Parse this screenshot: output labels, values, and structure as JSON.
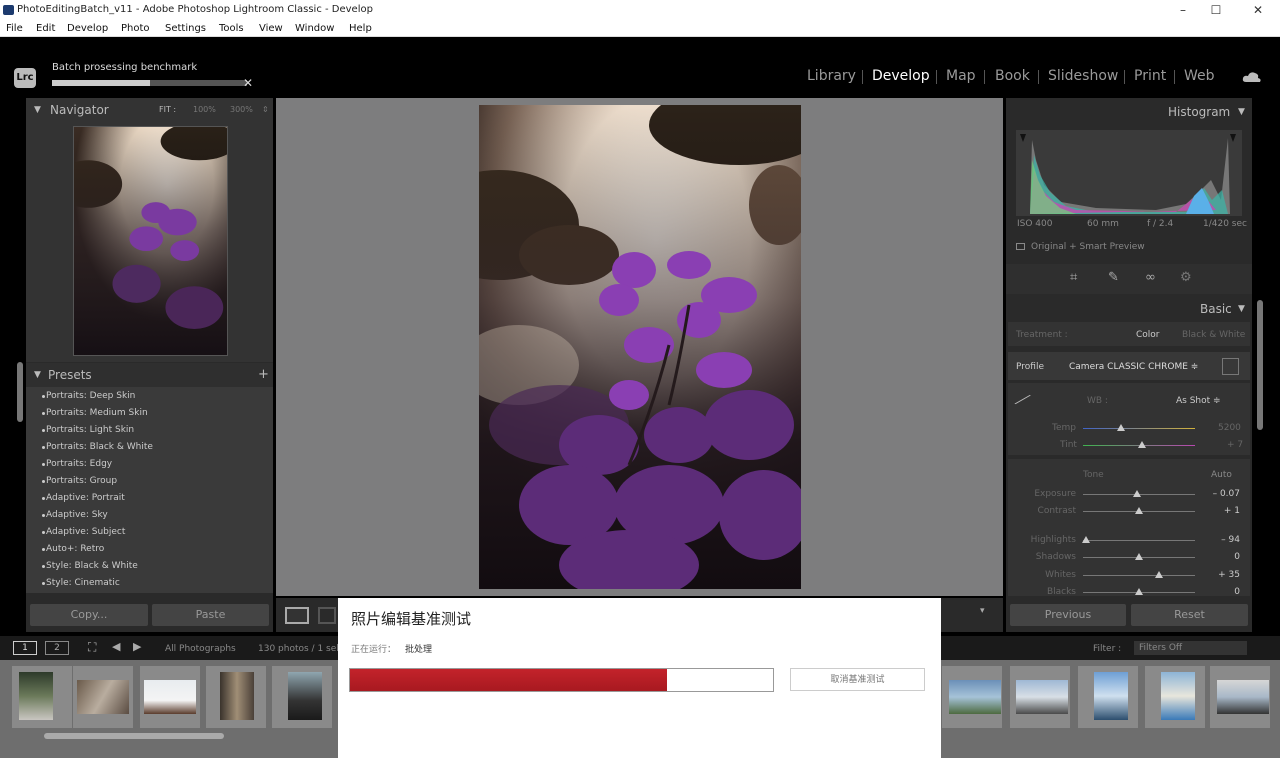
{
  "window": {
    "title": "PhotoEditingBatch_v11 - Adobe Photoshop Lightroom Classic - Develop",
    "controls": [
      "–",
      "☐",
      "✕"
    ]
  },
  "menu": [
    "File",
    "Edit",
    "Develop",
    "Photo",
    "Settings",
    "Tools",
    "View",
    "Window",
    "Help"
  ],
  "app": {
    "logo": "Lrc"
  },
  "background_job": {
    "label": "Batch prosessing benchmark",
    "progress": 0.5
  },
  "modules": [
    "Library",
    "Develop",
    "Map",
    "Book",
    "Slideshow",
    "Print",
    "Web"
  ],
  "active_module": "Develop",
  "navigator": {
    "title": "Navigator",
    "zoom_options": [
      "FIT :",
      "100%",
      "300%"
    ]
  },
  "presets": {
    "title": "Presets",
    "items": [
      "Portraits: Deep Skin",
      "Portraits: Medium Skin",
      "Portraits: Light Skin",
      "Portraits: Black & White",
      "Portraits: Edgy",
      "Portraits: Group",
      "Adaptive: Portrait",
      "Adaptive: Sky",
      "Adaptive: Subject",
      "Auto+: Retro",
      "Style: Black & White",
      "Style: Cinematic"
    ]
  },
  "left_buttons": {
    "copy": "Copy...",
    "paste": "Paste"
  },
  "histogram": {
    "title": "Histogram",
    "iso": "ISO 400",
    "focal": "60 mm",
    "aperture": "f / 2.4",
    "shutter": "1/420 sec",
    "preview": "Original + Smart Preview"
  },
  "basic": {
    "title": "Basic",
    "treatment_label": "Treatment :",
    "treatment_color": "Color",
    "treatment_bw": "Black & White",
    "profile_label": "Profile",
    "profile_value": "Camera CLASSIC CHROME ≑",
    "wb_label": "WB :",
    "wb_value": "As Shot ≑",
    "temp_label": "Temp",
    "temp_value": "5200",
    "tint_label": "Tint",
    "tint_value": "+ 7",
    "tone_label": "Tone",
    "tone_auto": "Auto",
    "sliders": [
      {
        "label": "Exposure",
        "value": "– 0.07",
        "level": 0.48
      },
      {
        "label": "Contrast",
        "value": "+ 1",
        "level": 0.5
      },
      {
        "label": "Highlights",
        "value": "– 94",
        "level": 0.03
      },
      {
        "label": "Shadows",
        "value": "0",
        "level": 0.5
      },
      {
        "label": "Whites",
        "value": "+ 35",
        "level": 0.68
      },
      {
        "label": "Blacks",
        "value": "0",
        "level": 0.5
      }
    ]
  },
  "right_buttons": {
    "previous": "Previous",
    "reset": "Reset"
  },
  "filmstrip_bar": {
    "page1": "1",
    "page2": "2",
    "source": "All Photographs",
    "count": "130 photos / 1 sel",
    "filter_label": "Filter :",
    "filter_value": "Filters Off"
  },
  "dialog": {
    "title": "照片编辑基准测试",
    "status_label": "正在运行：",
    "status_value": "批处理",
    "progress": 0.75,
    "cancel_label": "取消基准测试"
  },
  "colors": {
    "accent_red": "#b81f26",
    "panel_bg": "#2a2a2a",
    "canvas_bg": "#7d7d7e"
  }
}
